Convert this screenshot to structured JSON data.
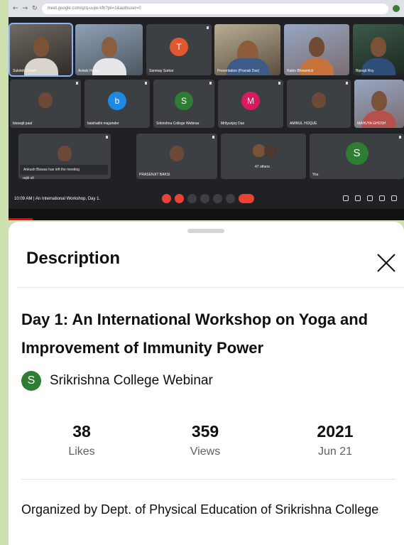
{
  "meet": {
    "url": "meet.google.com/qzq-uujw-kfh?pli=1&authuser=0",
    "participants": [
      {
        "name": "Sukdeb Ghosh"
      },
      {
        "name": "Avisek Hazra"
      },
      {
        "name": "Sanmay Sarkar",
        "initial": "T",
        "color": "#e2572d"
      },
      {
        "name": "Presentation (Pranab Das)"
      },
      {
        "name": "Rabin Bhowmick"
      },
      {
        "name": "Biprajit Roy"
      },
      {
        "name": "biswajit paul"
      },
      {
        "name": "baishakhi majumder",
        "initial": "b",
        "color": "#1e88e5"
      },
      {
        "name": "Srikrishna College Webinar",
        "initial": "S",
        "color": "#2e7d32"
      },
      {
        "name": "Mrityunjoy Das",
        "initial": "M",
        "color": "#d81b60"
      },
      {
        "name": "AMINUL HOQUE"
      },
      {
        "name": "MAHUYA GHOSH"
      },
      {
        "name": "rajib sil"
      },
      {
        "name": "PRASENJIT BAKSI"
      },
      {
        "name": "47 others"
      },
      {
        "name": "You",
        "initial": "S",
        "color": "#2e7d32"
      }
    ],
    "toast": "Ankush Biswas has left the meeting",
    "toast2": "rajib sil creww",
    "meeting_info": "10:09 AM  |  An International Workshop, Day 1."
  },
  "sheet": {
    "title": "Description",
    "video_title": "Day 1: An International Workshop on Yoga and Improvement of Immunity Power",
    "channel": {
      "initial": "S",
      "name": "Srikrishna College Webinar"
    },
    "stats": [
      {
        "value": "38",
        "label": "Likes"
      },
      {
        "value": "359",
        "label": "Views"
      },
      {
        "value": "2021",
        "label": "Jun 21"
      }
    ],
    "description": "Organized by Dept. of Physical Education of Srikrishna College"
  },
  "colors": {
    "accent_red": "#ff0000",
    "meet_bg": "#202124",
    "page_bg": "#cfe0b0"
  }
}
